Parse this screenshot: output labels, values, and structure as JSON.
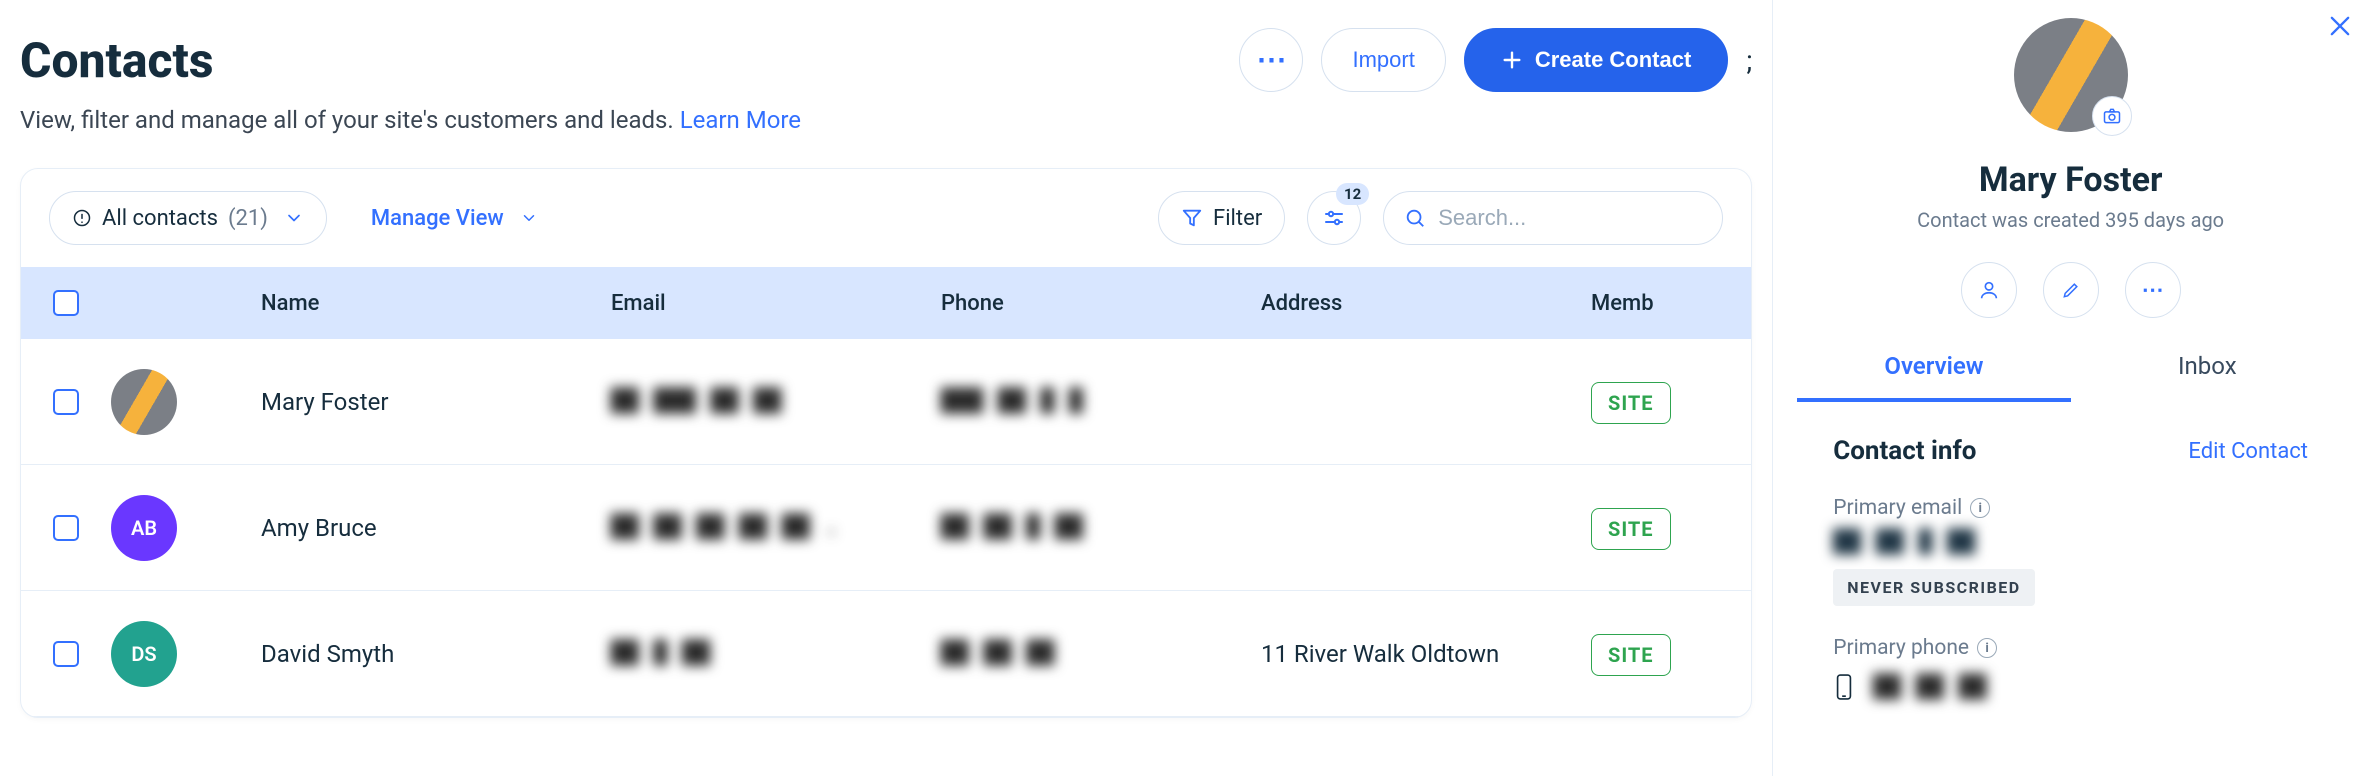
{
  "header": {
    "title": "Contacts",
    "subtitle": "View, filter and manage all of your site's customers and leads.",
    "learn_more": "Learn More",
    "more_button": "⋯",
    "import_label": "Import",
    "create_label": "Create Contact",
    "trailing_char": ";"
  },
  "toolbar": {
    "view_label": "All contacts",
    "count": "(21)",
    "manage_view": "Manage View",
    "filter_label": "Filter",
    "settings_badge": "12",
    "search_placeholder": "Search..."
  },
  "columns": {
    "name": "Name",
    "email": "Email",
    "phone": "Phone",
    "address": "Address",
    "member": "Memb"
  },
  "rows": [
    {
      "name": "Mary Foster",
      "avatar_type": "photo",
      "initials": "",
      "avatar_bg": "#7b7f86",
      "email": "██ ███ ██ ██",
      "phone": "███ ██  █  █",
      "address": "",
      "member": "SITE"
    },
    {
      "name": "Amy Bruce",
      "avatar_type": "initials",
      "initials": "AB",
      "avatar_bg": "#6a37ff",
      "email": "██ ██ ██ ██ ██ .",
      "phone": "██ ██ █ ██",
      "address": "",
      "member": "SITE"
    },
    {
      "name": "David Smyth",
      "avatar_type": "initials",
      "initials": "DS",
      "avatar_bg": "#22a28f",
      "email": "██  █  ██",
      "phone": "██ ██ ██",
      "address": "11 River Walk Oldtown",
      "member": "SITE"
    }
  ],
  "side": {
    "name": "Mary Foster",
    "created_text": "Contact was created 395 days ago",
    "tabs": {
      "overview": "Overview",
      "inbox": "Inbox"
    },
    "section_title": "Contact info",
    "edit_label": "Edit Contact",
    "primary_email_label": "Primary email",
    "primary_email_value": "██ ██ █ ██",
    "subscription_badge": "NEVER SUBSCRIBED",
    "primary_phone_label": "Primary phone",
    "primary_phone_value": "██ ██ ██"
  }
}
